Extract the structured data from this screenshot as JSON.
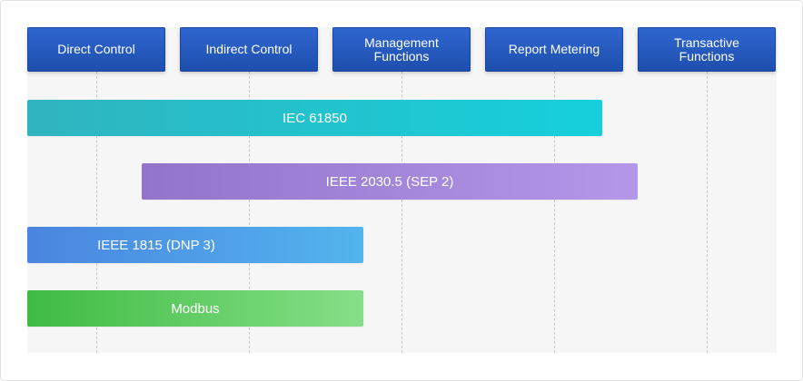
{
  "headers": [
    {
      "label": "Direct Control"
    },
    {
      "label": "Indirect Control"
    },
    {
      "label": "Management\nFunctions"
    },
    {
      "label": "Report Metering"
    },
    {
      "label": "Transactive\nFunctions"
    }
  ],
  "protocols": [
    {
      "label": "IEC 61850"
    },
    {
      "label": "IEEE 2030.5 (SEP 2)"
    },
    {
      "label": "IEEE 1815 (DNP 3)"
    },
    {
      "label": "Modbus"
    }
  ],
  "colors": {
    "header": "#2458bd",
    "iec61850": "#22c2ce",
    "ieee2030_5": "#a385da",
    "ieee1815": "#4f9de6",
    "modbus": "#62cd65"
  }
}
